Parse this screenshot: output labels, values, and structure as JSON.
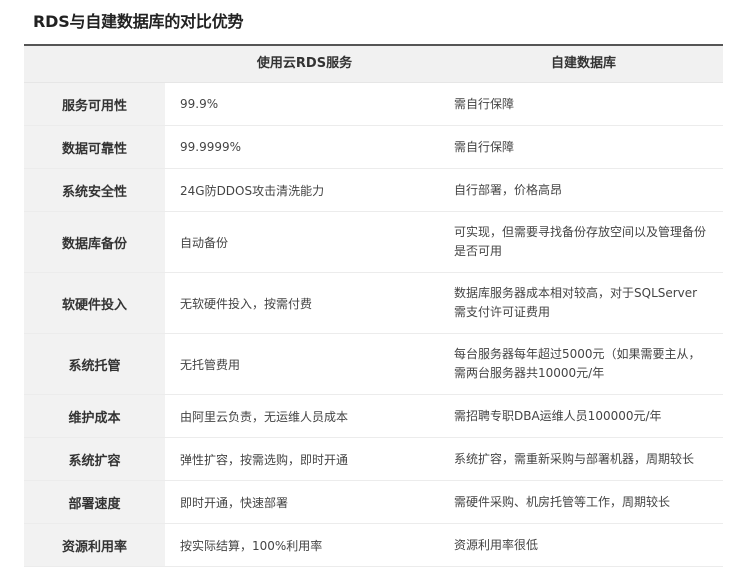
{
  "title": "RDS与自建数据库的对比优势",
  "table": {
    "headers": [
      "",
      "使用云RDS服务",
      "自建数据库"
    ],
    "rows": [
      {
        "label": "服务可用性",
        "rds": "99.9%",
        "self": "需自行保障"
      },
      {
        "label": "数据可靠性",
        "rds": "99.9999%",
        "self": "需自行保障"
      },
      {
        "label": "系统安全性",
        "rds": "24G防DDOS攻击清洗能力",
        "self": "自行部署，价格高昂"
      },
      {
        "label": "数据库备份",
        "rds": "自动备份",
        "self": "可实现，但需要寻找备份存放空间以及管理备份是否可用"
      },
      {
        "label": "软硬件投入",
        "rds": "无软硬件投入，按需付费",
        "self": "数据库服务器成本相对较高，对于SQLServer需支付许可证费用"
      },
      {
        "label": "系统托管",
        "rds": "无托管费用",
        "self": "每台服务器每年超过5000元（如果需要主从，需两台服务器共10000元/年"
      },
      {
        "label": "维护成本",
        "rds": "由阿里云负责，无运维人员成本",
        "self": "需招聘专职DBA运维人员100000元/年"
      },
      {
        "label": "系统扩容",
        "rds": "弹性扩容，按需选购，即时开通",
        "self": "系统扩容，需重新采购与部署机器，周期较长"
      },
      {
        "label": "部署速度",
        "rds": "即时开通，快速部署",
        "self": "需硬件采购、机房托管等工作，周期较长"
      },
      {
        "label": "资源利用率",
        "rds": "按实际结算，100%利用率",
        "self": "资源利用率很低"
      }
    ]
  }
}
